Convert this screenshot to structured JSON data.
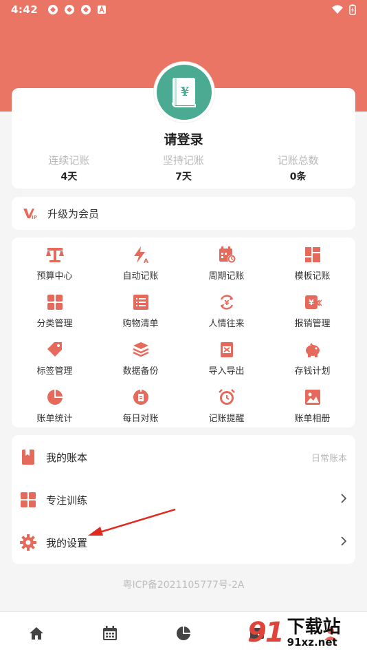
{
  "status_bar": {
    "time": "4:42"
  },
  "profile": {
    "login_prompt": "请登录",
    "stats": [
      {
        "label": "连续记账",
        "value": "4天"
      },
      {
        "label": "坚持记账",
        "value": "7天"
      },
      {
        "label": "记账总数",
        "value": "0条"
      }
    ]
  },
  "vip": {
    "label": "升级为会员"
  },
  "grid": [
    {
      "label": "预算中心",
      "icon": "scale-icon"
    },
    {
      "label": "自动记账",
      "icon": "lightning-icon"
    },
    {
      "label": "周期记账",
      "icon": "calendar-cycle-icon"
    },
    {
      "label": "模板记账",
      "icon": "template-icon"
    },
    {
      "label": "分类管理",
      "icon": "category-icon"
    },
    {
      "label": "购物清单",
      "icon": "list-icon"
    },
    {
      "label": "人情往来",
      "icon": "exchange-icon"
    },
    {
      "label": "报销管理",
      "icon": "reimburse-icon"
    },
    {
      "label": "标签管理",
      "icon": "tag-icon"
    },
    {
      "label": "数据备份",
      "icon": "layers-icon"
    },
    {
      "label": "导入导出",
      "icon": "excel-icon"
    },
    {
      "label": "存钱计划",
      "icon": "piggy-bank-icon"
    },
    {
      "label": "账单统计",
      "icon": "pie-chart-icon"
    },
    {
      "label": "每日对账",
      "icon": "daily-check-icon"
    },
    {
      "label": "记账提醒",
      "icon": "alarm-icon"
    },
    {
      "label": "账单相册",
      "icon": "photo-icon"
    }
  ],
  "list": {
    "my_book": {
      "label": "我的账本",
      "value": "日常账本"
    },
    "focus": {
      "label": "专注训练"
    },
    "settings": {
      "label": "我的设置"
    }
  },
  "icp": "粤ICP备2021105777号-2A",
  "watermark": {
    "number": "91",
    "title": "下载站",
    "url": "91xz.net"
  },
  "colors": {
    "accent": "#ea7565",
    "avatar": "#4bab92",
    "icon": "#e56a5b"
  }
}
